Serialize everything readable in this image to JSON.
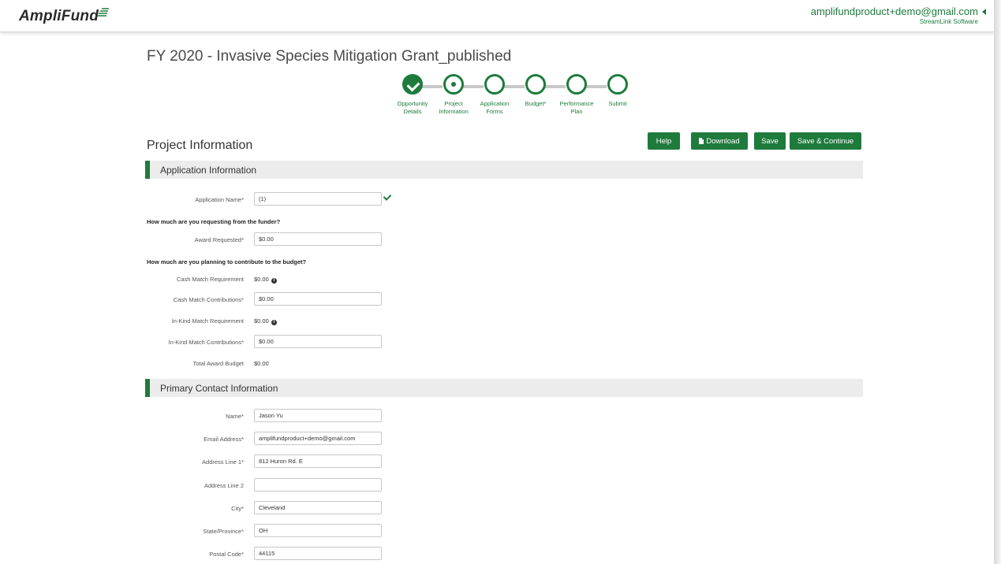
{
  "header": {
    "logo_text": "AmpliFund",
    "user_email": "amplifundproduct+demo@gmail.com",
    "user_company": "StreamLink Software",
    "accent_color": "#1e7b3c"
  },
  "page_title": "FY 2020 - Invasive Species Mitigation Grant_published",
  "stepper": {
    "steps": [
      {
        "label": "Opportunity\nDetails",
        "state": "complete"
      },
      {
        "label": "Project\nInformation",
        "state": "current"
      },
      {
        "label": "Application\nForms",
        "state": "pending"
      },
      {
        "label": "Budget*",
        "state": "pending"
      },
      {
        "label": "Performance\nPlan",
        "state": "pending"
      },
      {
        "label": "Submit",
        "state": "pending"
      }
    ]
  },
  "section_title": "Project Information",
  "toolbar": {
    "help_label": "Help",
    "download_label": "Download",
    "save_label": "Save",
    "save_continue_label": "Save & Continue"
  },
  "application_info": {
    "title": "Application Information",
    "application_name_label": "Application Name*",
    "application_name_value": "(1)",
    "question_request": "How much are you requesting from the funder?",
    "award_requested_label": "Award Requested*",
    "award_requested_value": "$0.00",
    "question_contribute": "How much are you planning to contribute to the budget?",
    "cash_match_req_label": "Cash Match Requirement",
    "cash_match_req_value": "$0.00",
    "cash_match_contrib_label": "Cash Match Contributions*",
    "cash_match_contrib_value": "$0.00",
    "inkind_match_req_label": "In-Kind Match Requirement",
    "inkind_match_req_value": "$0.00",
    "inkind_match_contrib_label": "In-Kind Match Contributions*",
    "inkind_match_contrib_value": "$0.00",
    "total_award_label": "Total Award Budget",
    "total_award_value": "$0.00"
  },
  "primary_contact": {
    "title": "Primary Contact Information",
    "name_label": "Name*",
    "name_value": "Jason Yu",
    "email_label": "Email Address*",
    "email_value": "amplifundproduct+demo@gmail.com",
    "address1_label": "Address Line 1*",
    "address1_value": "812 Huron Rd. E",
    "address2_label": "Address Line 2",
    "address2_value": "",
    "city_label": "City*",
    "city_value": "Cleveland",
    "state_label": "State/Province*",
    "state_value": "OH",
    "postal_label": "Postal Code*",
    "postal_value": "44115"
  }
}
